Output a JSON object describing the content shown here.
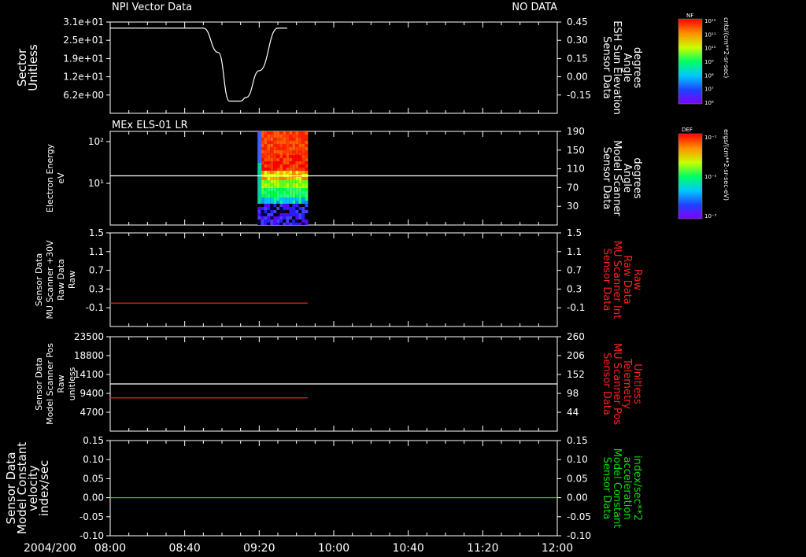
{
  "header": {
    "title": "NPI Vector Data",
    "status": "NO DATA"
  },
  "time_axis": {
    "date": "2004/200",
    "ticks": [
      "08:00",
      "08:40",
      "09:20",
      "10:00",
      "10:40",
      "11:20",
      "12:00"
    ]
  },
  "colors": {
    "white": "#ffffff",
    "red": "#ff2020",
    "green": "#00dd00",
    "background": "#000000"
  },
  "chart_data": [
    {
      "type": "line",
      "panel_title": "",
      "ylabel": [
        "Sector",
        "Unitless"
      ],
      "ylabel2": [
        "Sensor Data",
        "ESH Sun Elevation",
        "Angle",
        "degrees"
      ],
      "ylabel2_color": "#ffffff",
      "y_ticks": [
        "3.1e+01",
        "2.5e+01",
        "1.9e+01",
        "1.2e+01",
        "6.2e+00"
      ],
      "y2_ticks": [
        "0.45",
        "0.30",
        "0.15",
        "0.00",
        "-0.15"
      ],
      "series": [
        {
          "axis": "right",
          "color": "#ffffff",
          "x": [
            "08:00",
            "08:50",
            "08:58",
            "09:04",
            "09:10",
            "09:13",
            "09:20",
            "09:30",
            "09:35"
          ],
          "y": [
            0.4,
            0.4,
            0.2,
            -0.2,
            -0.2,
            -0.17,
            0.05,
            0.4,
            0.4
          ]
        }
      ]
    },
    {
      "type": "heatmap",
      "panel_title": "MEx ELS-01 LR",
      "ylabel": [
        "Electron Energy",
        "eV"
      ],
      "ylabel2": [
        "Sensor Data",
        "Model Scanner",
        "Angle",
        "degrees"
      ],
      "ylabel2_color": "#ffffff",
      "y_ticks": [
        "10²",
        "10¹"
      ],
      "y2_ticks": [
        "190",
        "150",
        "110",
        "70",
        "30"
      ],
      "heatmap": {
        "x_start": "09:20",
        "x_end": "09:46"
      },
      "series": [
        {
          "axis": "right",
          "color": "#ffffff",
          "x": [
            "08:00",
            "12:00"
          ],
          "y": [
            95,
            95
          ]
        }
      ]
    },
    {
      "type": "line",
      "panel_title": "",
      "ylabel": [
        "Sensor Data",
        "MU Scanner +30V",
        "Raw Data",
        "Raw"
      ],
      "ylabel2": [
        "Sensor Data",
        "MU Scanner Int",
        "Raw Data",
        "Raw"
      ],
      "ylabel2_color": "#ff2020",
      "y_ticks": [
        "1.5",
        "1.1",
        "0.7",
        "0.3",
        "-0.1"
      ],
      "y2_ticks": [
        "1.5",
        "1.1",
        "0.7",
        "0.3",
        "-0.1"
      ],
      "series": [
        {
          "axis": "right",
          "color": "#ff2020",
          "x": [
            "08:00",
            "09:46"
          ],
          "y": [
            0.0,
            0.0
          ]
        }
      ]
    },
    {
      "type": "line",
      "panel_title": "",
      "ylabel": [
        "Sensor Data",
        "Model Scanner Pos",
        "Raw",
        "unitless"
      ],
      "ylabel2": [
        "Sensor Data",
        "MU Scanner Pos",
        "Telemetry",
        "Unitless"
      ],
      "ylabel2_color": "#ff2020",
      "y_ticks": [
        "23500",
        "18800",
        "14100",
        "9400",
        "4700"
      ],
      "y2_ticks": [
        "260",
        "206",
        "152",
        "98",
        "44"
      ],
      "series": [
        {
          "axis": "left",
          "color": "#ffffff",
          "x": [
            "08:00",
            "12:00"
          ],
          "y": [
            11750,
            11750
          ]
        },
        {
          "axis": "right",
          "color": "#ff2020",
          "x": [
            "08:00",
            "09:46"
          ],
          "y": [
            85,
            85
          ]
        }
      ]
    },
    {
      "type": "line",
      "panel_title": "",
      "ylabel": [
        "Sensor Data",
        "Model Constant",
        "velocity",
        "index/sec"
      ],
      "ylabel2": [
        "Sensor Data",
        "Model Constant",
        "acceleration",
        "index/sec**2"
      ],
      "ylabel2_color": "#00dd00",
      "y_ticks": [
        "0.15",
        "0.10",
        "0.05",
        "0.00",
        "-0.05",
        "-0.10"
      ],
      "y2_ticks": [
        "0.15",
        "0.10",
        "0.05",
        "0.00",
        "-0.05",
        "-0.10"
      ],
      "series": [
        {
          "axis": "right",
          "color": "#00dd00",
          "x": [
            "08:00",
            "12:00"
          ],
          "y": [
            0.0,
            0.0
          ]
        }
      ]
    }
  ],
  "colorbars": [
    {
      "tag": "NF",
      "unit": "cnts/(cm**2-sr-sec)",
      "labels": [
        "10¹²",
        "10¹¹",
        "10¹⁰",
        "10⁹",
        "10⁸",
        "10⁷",
        "10⁶"
      ]
    },
    {
      "tag": "DEF",
      "unit": "ergs/(cm**2-sr-sec-eV)",
      "labels": [
        "10⁻¹",
        "10⁻²",
        "10⁻³"
      ]
    }
  ]
}
